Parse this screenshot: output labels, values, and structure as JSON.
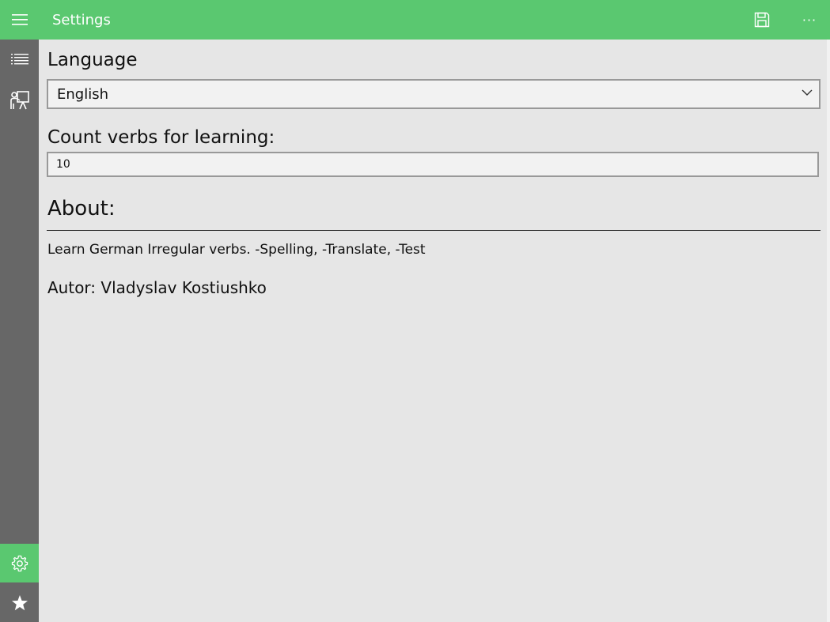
{
  "header": {
    "title": "Settings",
    "menu_icon": "hamburger-icon",
    "save_icon": "save-icon",
    "more_label": "···"
  },
  "sidebar": {
    "items": [
      {
        "icon": "list-icon"
      },
      {
        "icon": "teacher-board-icon"
      },
      {
        "icon": "gear-icon",
        "active": true
      },
      {
        "icon": "star-icon"
      }
    ]
  },
  "settings": {
    "language_label": "Language",
    "language_value": "English",
    "count_label": "Count verbs for learning:",
    "count_value": "10"
  },
  "about": {
    "heading": "About:",
    "description": "Learn German Irregular verbs. -Spelling, -Translate, -Test",
    "author": "Autor: Vladyslav Kostiushko"
  },
  "colors": {
    "accent": "#5ac870",
    "sidebar": "#676767",
    "background": "#e6e6e6"
  }
}
